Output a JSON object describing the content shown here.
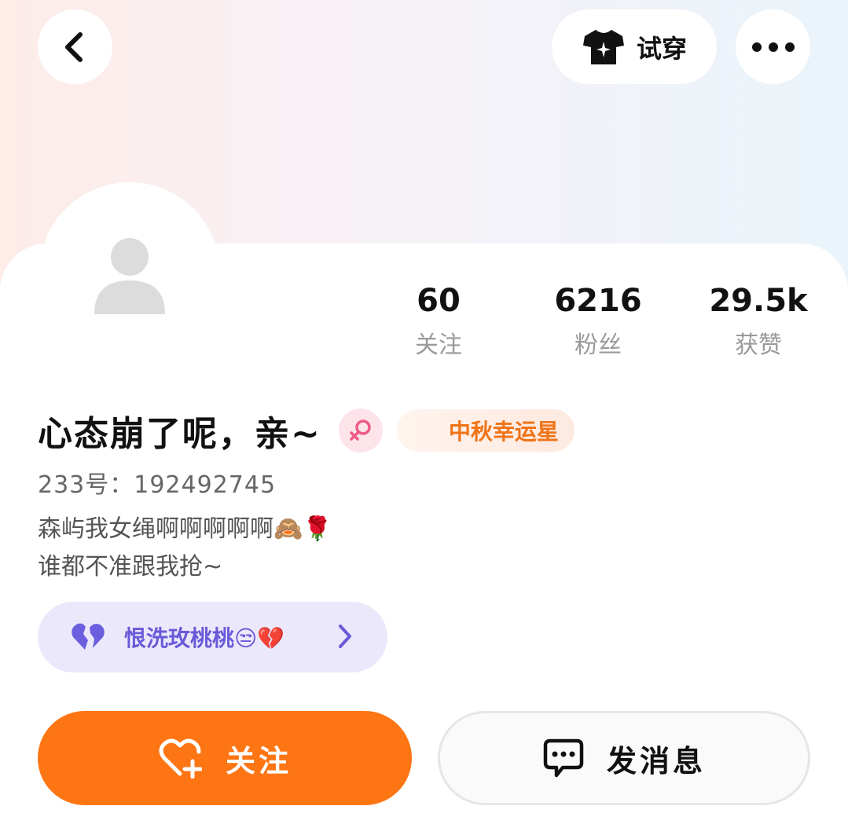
{
  "top_bar": {
    "back_icon": "chevron-left-icon",
    "try_on_label": "试穿",
    "try_on_icon": "tshirt-sparkle-icon",
    "more_icon": "more-dots-icon"
  },
  "stats": [
    {
      "value": "60",
      "label": "关注"
    },
    {
      "value": "6216",
      "label": "粉丝"
    },
    {
      "value": "29.5k",
      "label": "获赞"
    }
  ],
  "profile": {
    "name": "心态崩了呢，亲~",
    "gender_icon": "female-icon",
    "badge_label": "中秋幸运星",
    "id_line": "233号：192492745",
    "bio_line1": "森屿我女绳啊啊啊啊啊🙈🌹",
    "bio_line2": "谁都不准跟我抢~"
  },
  "relation": {
    "icon": "purple-heart-icon",
    "text": "恨洗玫桃桃😒💔"
  },
  "actions": {
    "follow_label": "关注",
    "message_label": "发消息"
  },
  "colors": {
    "accent": "#fe7514",
    "relation_text": "#6a5ad8",
    "badge_text": "#f07316"
  }
}
